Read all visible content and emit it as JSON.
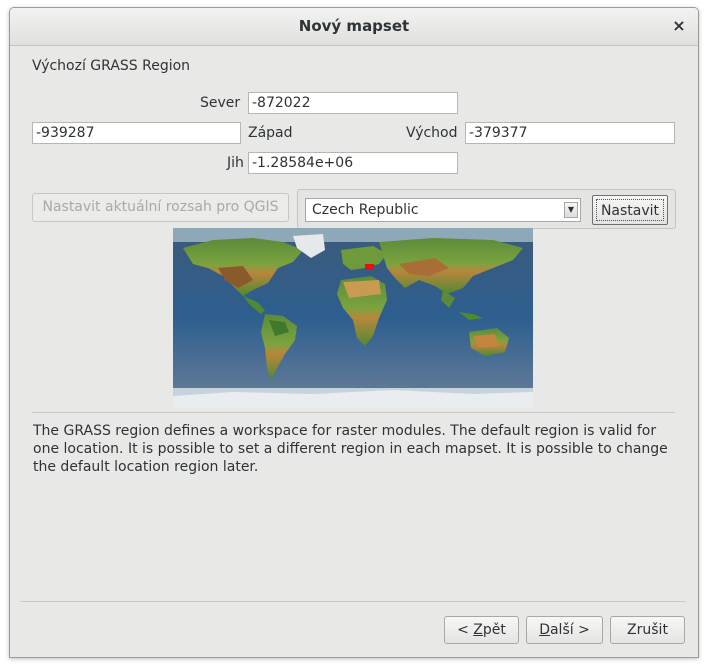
{
  "window": {
    "title": "Nový mapset",
    "close_glyph": "×"
  },
  "region": {
    "heading": "Výchozí GRASS Region",
    "north_label": "Sever",
    "north_value": "-872022",
    "west_label": "Západ",
    "west_value": "-939287",
    "east_label": "Východ",
    "east_value": "-379377",
    "south_label": "Jih",
    "south_value": "-1.28584e+06"
  },
  "actions": {
    "set_qgis_extent": "Nastavit aktuální rozsah pro QGIS",
    "country_selected": "Czech Republic",
    "set_button": "Nastavit"
  },
  "map": {
    "selection_color": "#e81010"
  },
  "description": "The GRASS region defines a workspace for raster modules. The default region is valid for one location. It is possible to set a different region in each mapset. It is possible to change the default location region later.",
  "footer": {
    "back_prefix": "< ",
    "back_key": "Z",
    "back_rest": "pět",
    "next_key": "D",
    "next_rest": "alší",
    "next_suffix": " >",
    "cancel": "Zrušit"
  }
}
